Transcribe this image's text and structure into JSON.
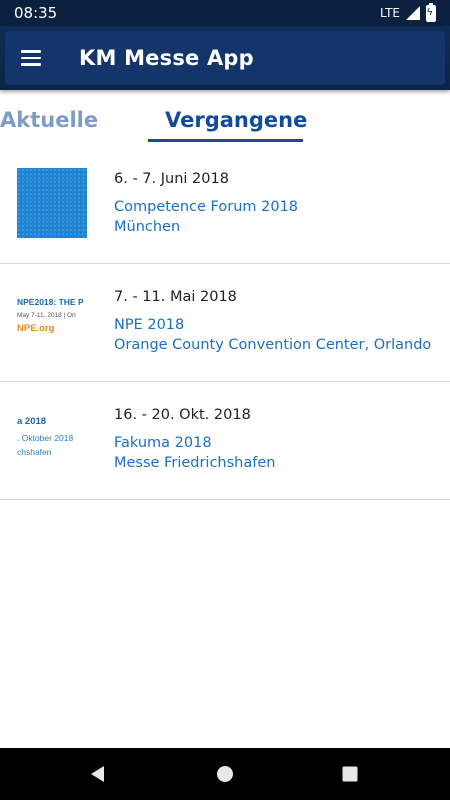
{
  "status_bar": {
    "time": "08:35",
    "network": "LTE",
    "icons": [
      "signal-icon",
      "battery-charging-icon"
    ]
  },
  "app_bar": {
    "title": "KM Messe App",
    "menu_icon": "hamburger-menu-icon"
  },
  "tabs": [
    {
      "label": "Aktuelle",
      "selected": false
    },
    {
      "label": "Vergangene",
      "selected": true
    }
  ],
  "events": [
    {
      "date": "6. - 7. Juni 2018",
      "name": "Competence Forum 2018",
      "location": "München",
      "thumbnail": "blue-texture-image"
    },
    {
      "date": "7. - 11. Mai 2018",
      "name": "NPE 2018",
      "location": "Orange County Convention Center, Orlando",
      "thumbnail": "npe-logo-image",
      "thumb_lines": [
        "NPE2018: THE P",
        "May 7-11, 2018  |  Orl",
        "NPE.org"
      ]
    },
    {
      "date": "16. - 20. Okt. 2018",
      "name": "Fakuma 2018",
      "location": "Messe Friedrichshafen",
      "thumbnail": "fakuma-logo-image",
      "thumb_lines": [
        "a 2018",
        ". Oktober 2018",
        "chshafen"
      ]
    }
  ],
  "nav_bar": {
    "icons": [
      "back-icon",
      "home-icon",
      "recent-apps-icon"
    ]
  },
  "colors": {
    "app_bar": "#14356a",
    "accent": "#154a9a",
    "link": "#1c6fc2",
    "inactive_tab": "#7f9cc8"
  }
}
